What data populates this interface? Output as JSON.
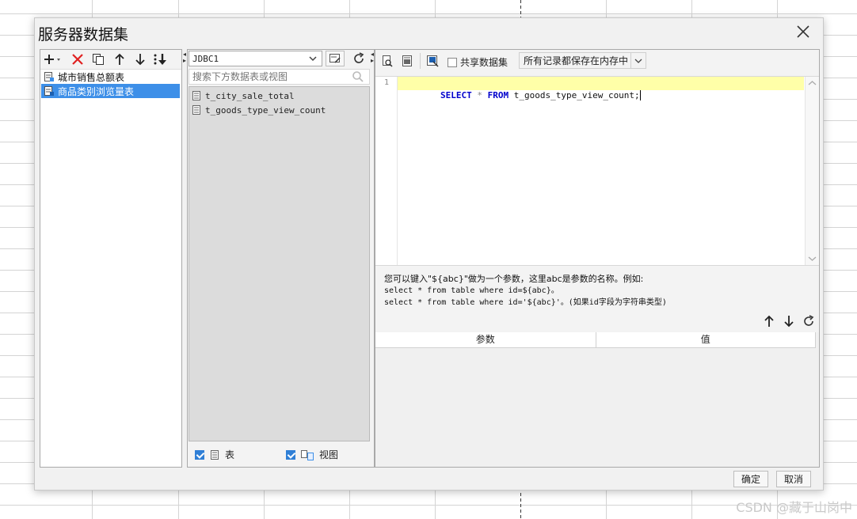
{
  "dialog": {
    "title": "服务器数据集",
    "ok_label": "确定",
    "cancel_label": "取消"
  },
  "datasets": {
    "items": [
      {
        "label": "城市销售总额表",
        "selected": false
      },
      {
        "label": "商品类别浏览量表",
        "selected": true
      }
    ]
  },
  "source": {
    "connection": "JDBC1",
    "search_placeholder": "搜索下方数据表或视图",
    "tables": [
      "t_city_sale_total",
      "t_goods_type_view_count"
    ],
    "filter_table_label": "表",
    "filter_view_label": "视图"
  },
  "editor": {
    "share_label": "共享数据集",
    "cache_option": "所有记录都保存在内存中",
    "line_number": "1",
    "sql_select": "SELECT",
    "sql_star": "*",
    "sql_from": "FROM",
    "sql_table": "t_goods_type_view_count;"
  },
  "hint": {
    "line1": "您可以键入\"${abc}\"做为一个参数，这里abc是参数的名称。例如:",
    "line2": "select * from table where id=${abc}。",
    "line3": "select * from table where id='${abc}'。(如果id字段为字符串类型)"
  },
  "params": {
    "col_param": "参数",
    "col_value": "值"
  },
  "watermark": "CSDN @藏于山岗中",
  "colors": {
    "accent": "#3d8fe8",
    "delete": "#e02020",
    "sql_keyword": "#0000cc",
    "current_line": "#ffffa8"
  }
}
